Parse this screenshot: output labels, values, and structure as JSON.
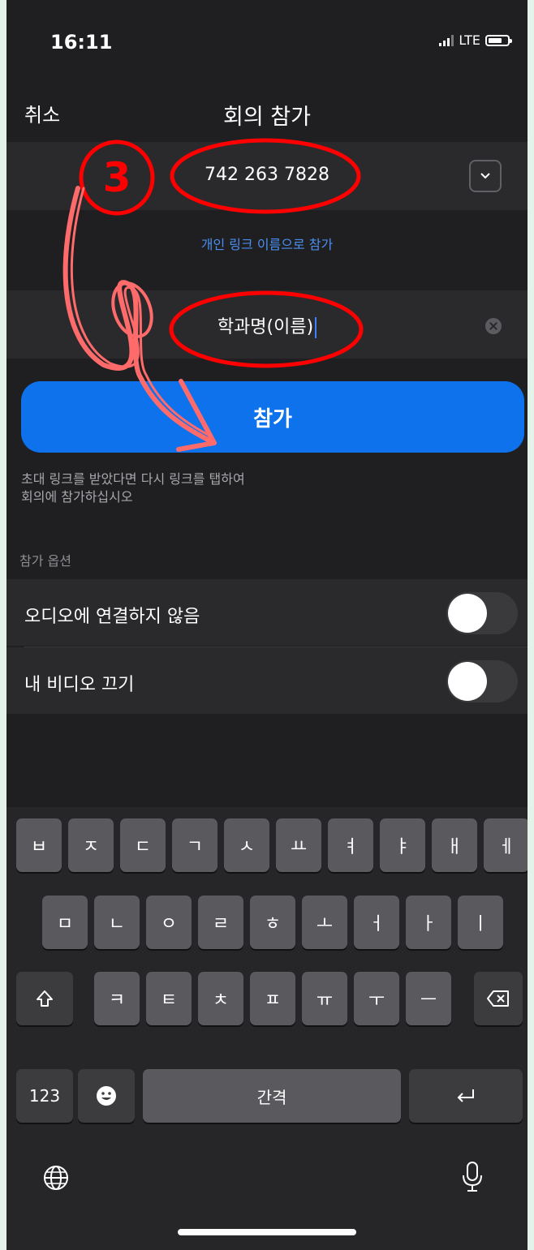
{
  "status": {
    "time": "16:11",
    "network": "LTE"
  },
  "nav": {
    "cancel": "취소",
    "title": "회의 참가"
  },
  "meeting_id": {
    "value": "742 263 7828"
  },
  "personal_link": "개인 링크 이름으로 참가",
  "name_field": {
    "value": "학과명(이름)"
  },
  "join_button": "참가",
  "hint": "초대 링크를 받았다면 다시 링크를 탭하여\n회의에 참가하십시오",
  "options": {
    "header": "참가 옵션",
    "items": [
      {
        "label": "오디오에 연결하지 않음",
        "on": false
      },
      {
        "label": "내 비디오 끄기",
        "on": false
      }
    ]
  },
  "annotation": {
    "step": "3",
    "color": "#ff0000",
    "arrow_color": "#ff6b6b"
  },
  "keyboard": {
    "row1": [
      "ㅂ",
      "ㅈ",
      "ㄷ",
      "ㄱ",
      "ㅅ",
      "ㅛ",
      "ㅕ",
      "ㅑ",
      "ㅐ",
      "ㅔ"
    ],
    "row2": [
      "ㅁ",
      "ㄴ",
      "ㅇ",
      "ㄹ",
      "ㅎ",
      "ㅗ",
      "ㅓ",
      "ㅏ",
      "ㅣ"
    ],
    "row3": [
      "ㅋ",
      "ㅌ",
      "ㅊ",
      "ㅍ",
      "ㅠ",
      "ㅜ",
      "ㅡ"
    ],
    "numbers": "123",
    "space": "간격",
    "icons": {
      "shift": "shift-icon",
      "delete": "delete-icon",
      "emoji": "emoji-icon",
      "return": "return-icon",
      "globe": "globe-icon",
      "mic": "microphone-icon"
    }
  }
}
